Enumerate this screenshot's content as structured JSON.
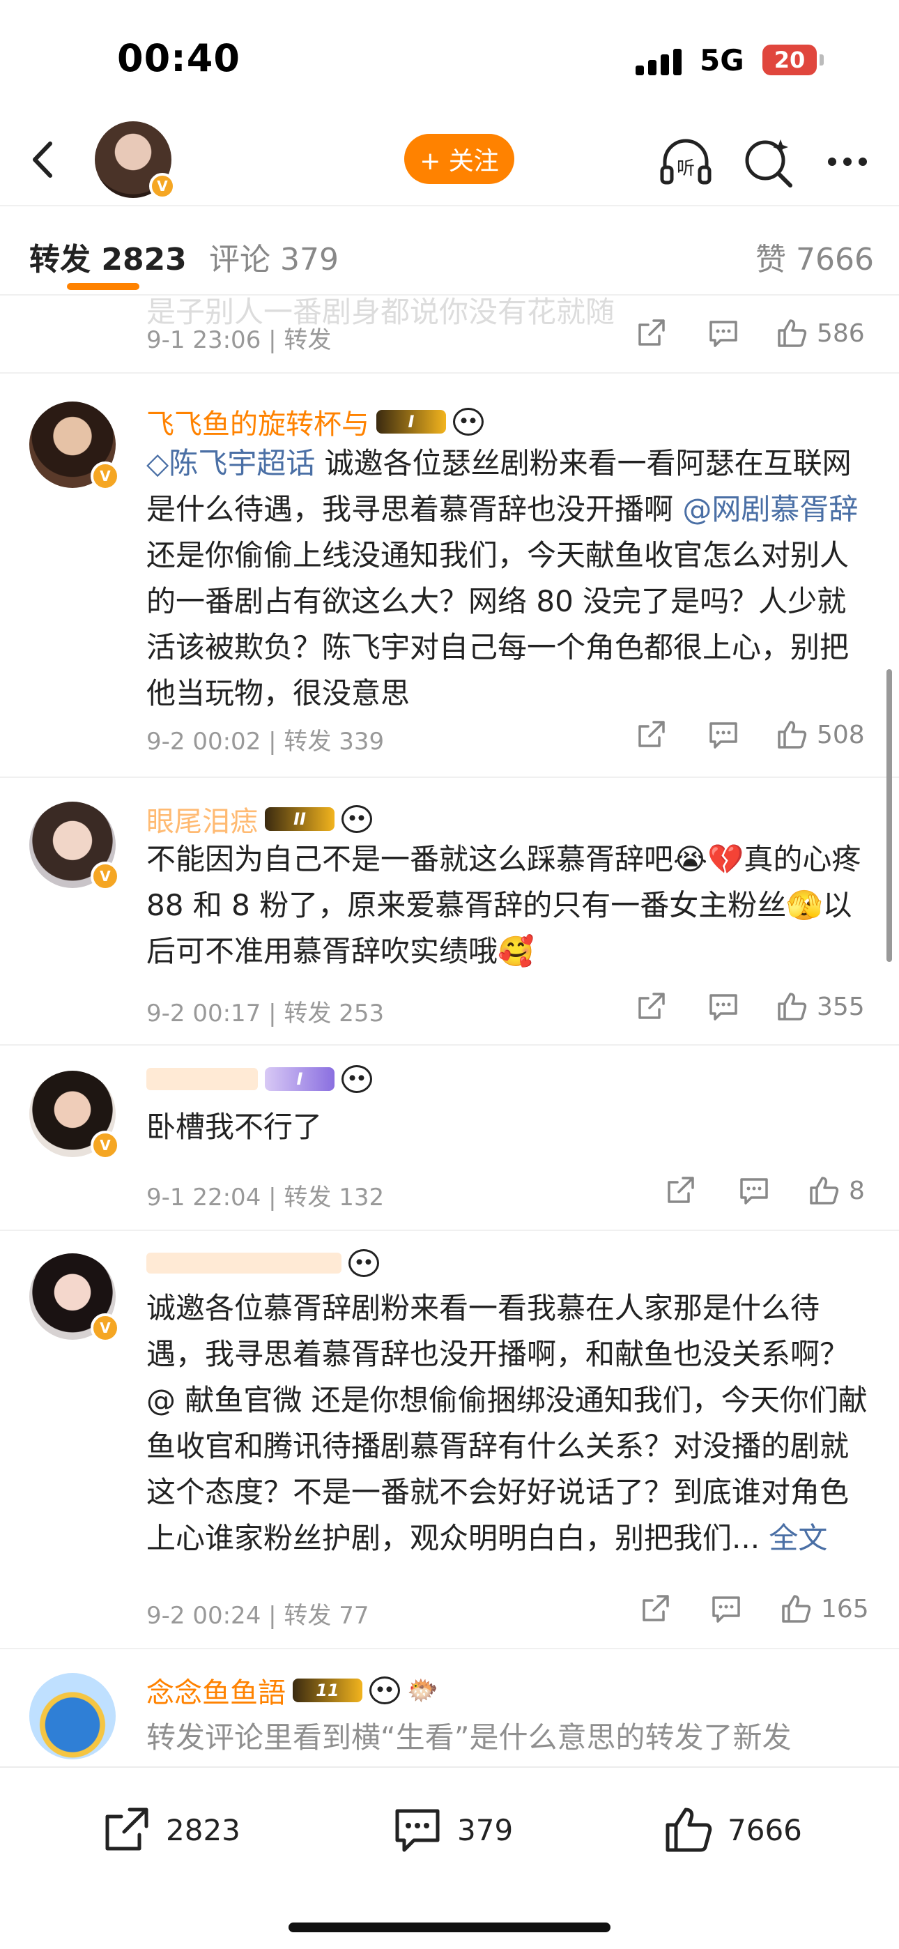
{
  "status_bar": {
    "time": "00:40",
    "network": "5G",
    "battery": "20"
  },
  "header": {
    "follow_label": "+ 关注",
    "listen_label": "听"
  },
  "tabs": {
    "repost": {
      "label": "转发",
      "count": "2823"
    },
    "comment": {
      "label": "评论",
      "count": "379"
    },
    "like": {
      "label": "赞",
      "count": "7666"
    }
  },
  "feed": {
    "top_partial": {
      "meta": "9-1 23:06 | 转发 ",
      "like_count": "586"
    },
    "items": [
      {
        "name": "飞飞鱼的旋转杯与",
        "medal": "I",
        "topic": "陈飞宇超话",
        "text_before": " 诚邀各位瑟丝剧粉来看一看阿瑟在互联网是什么待遇，我寻思着慕胥辞也没开播啊 ",
        "mention": "@网剧慕胥辞",
        "text_after": " 还是你偷偷上线没通知我们，今天献鱼收官怎么对别人的一番剧占有欲这么大？网络 80 没完了是吗？人少就活该被欺负？陈飞宇对自己每一个角色都很上心，别把他当玩物，很没意思",
        "meta": "9-2 00:02 | 转发 339",
        "like_count": "508"
      },
      {
        "name": "眼尾泪痣",
        "medal": "II",
        "text": "不能因为自己不是一番就这么踩慕胥辞吧😭💔真的心疼 88 和 8 粉了，原来爱慕胥辞的只有一番女主粉丝🫣以后可不准用慕胥辞吹实绩哦🥰",
        "meta": "9-2 00:17 | 转发 253",
        "like_count": "355"
      },
      {
        "name": "",
        "medal": "I",
        "text": "卧槽我不行了",
        "meta": "9-1 22:04 | 转发 132",
        "like_count": "8"
      },
      {
        "name": "",
        "medal": "",
        "text": "诚邀各位慕胥辞剧粉来看一看我慕在人家那是什么待遇，我寻思着慕胥辞也没开播啊，和献鱼也没关系啊？@ 献鱼官微 还是你想偷偷捆绑没通知我们，今天你们献鱼收官和腾讯待播剧慕胥辞有什么关系？对没播的剧就这个态度？不是一番就不会好好说话了？到底谁对角色上心谁家粉丝护剧，观众明明白白，别把我们... ",
        "fulltext": "全文",
        "meta": "9-2 00:24 | 转发 77",
        "like_count": "165"
      },
      {
        "name": "念念鱼鱼語",
        "medal": "11",
        "text": "转发评论里看到横“生看”是什么意思的转发了新发"
      }
    ]
  },
  "bottom_bar": {
    "share_count": "2823",
    "comment_count": "379",
    "like_count": "7666"
  },
  "colors": {
    "accent": "#ff8200",
    "link": "#4a6fa5",
    "meta": "#999999"
  }
}
